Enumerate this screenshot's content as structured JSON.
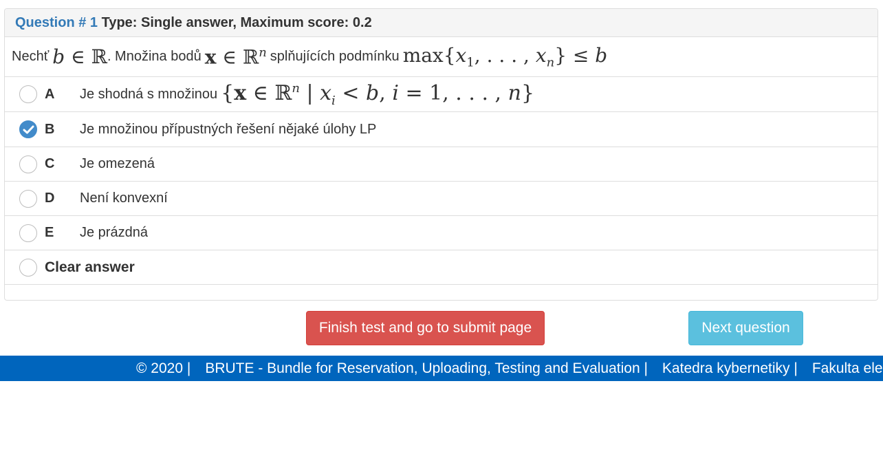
{
  "question": {
    "number_label": "Question # 1",
    "type_label": "Type: Single answer, Maximum score: 0.2",
    "text_prefix": "Nechť",
    "math_b_in_R": "b ∈ ℝ",
    "text_middle": ". Množina bodů",
    "math_x_in_Rn": "x ∈ ℝn",
    "text_suffix": "splňujících podmínku",
    "math_condition": "max{x1, . . . , xn} ≤ b"
  },
  "options": [
    {
      "letter": "A",
      "text": "Je shodná s množinou",
      "math": "{x ∈ ℝn | xi < b, i = 1, . . . , n}",
      "selected": false
    },
    {
      "letter": "B",
      "text": "Je množinou přípustných řešení nějaké úlohy LP",
      "selected": true
    },
    {
      "letter": "C",
      "text": "Je omezená",
      "selected": false
    },
    {
      "letter": "D",
      "text": "Není konvexní",
      "selected": false
    },
    {
      "letter": "E",
      "text": "Je prázdná",
      "selected": false
    }
  ],
  "clear_answer_label": "Clear answer",
  "buttons": {
    "finish": "Finish test and go to submit page",
    "next": "Next question"
  },
  "footer": {
    "copyright": "© 2020 |",
    "brute": "BRUTE - Bundle for Reservation, Uploading, Testing and Evaluation |",
    "department": "Katedra kybernetiky |",
    "faculty": "Fakulta ele"
  },
  "colors": {
    "question_number": "#337ab7",
    "radio_checked": "#428bca",
    "finish_button": "#d9534f",
    "next_button": "#5bc0de",
    "footer_bg": "#0065bd"
  },
  "icons": {
    "check": "check-icon"
  }
}
